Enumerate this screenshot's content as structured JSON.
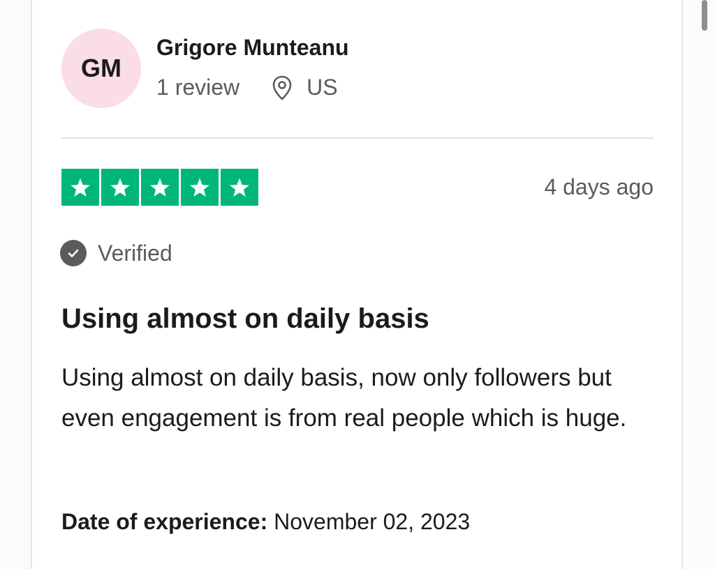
{
  "reviewer": {
    "initials": "GM",
    "name": "Grigore Munteanu",
    "review_count": "1 review",
    "location_icon": "location-pin-icon",
    "country": "US"
  },
  "rating": {
    "stars": 5,
    "max_stars": 5,
    "star_color": "#00b67a",
    "posted": "4 days ago"
  },
  "verified": {
    "icon": "check-circle-icon",
    "label": "Verified"
  },
  "review": {
    "title": "Using almost on daily basis",
    "body": "Using almost on daily basis, now only followers but even engagement is from real people which is huge."
  },
  "experience": {
    "label": "Date of experience:",
    "date": "November 02, 2023"
  },
  "colors": {
    "avatar_bg": "#fbdde6",
    "text": "#1b1b1b",
    "muted": "#5b5b5b"
  }
}
